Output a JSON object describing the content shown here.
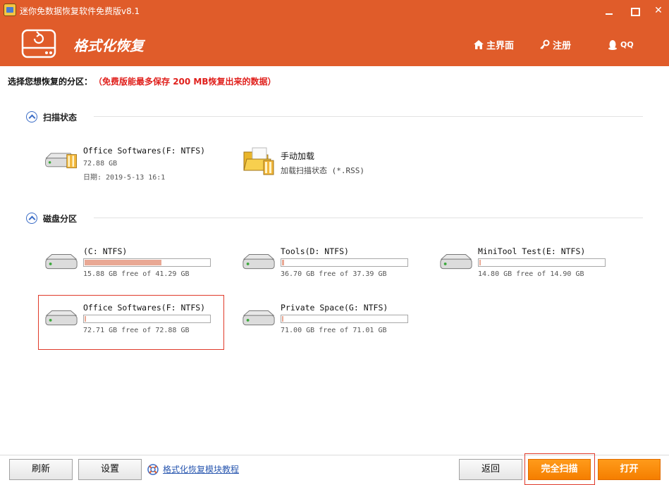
{
  "window": {
    "title": "迷你免数据恢复软件免费版v8.1"
  },
  "header": {
    "title": "格式化恢复",
    "nav": {
      "home": "主界面",
      "register": "注册",
      "qq": "QQ"
    }
  },
  "prompt": {
    "label": "选择您想恢复的分区：",
    "warning": "（免费版能最多保存 200 MB恢复出来的数据）"
  },
  "scan_state": {
    "title": "扫描状态",
    "last_scan": {
      "name": "Office Softwares(F: NTFS)",
      "size": "72.88 GB",
      "date": "日期: 2019-5-13 16:1"
    },
    "manual_load": {
      "name": "手动加载",
      "desc": "加载扫描状态 (*.RSS)"
    }
  },
  "disk_partitions": {
    "title": "磁盘分区",
    "items": [
      {
        "name": "(C: NTFS)",
        "free": "15.88 GB free of 41.29 GB",
        "used_fraction": 0.615
      },
      {
        "name": "Tools(D: NTFS)",
        "free": "36.70 GB free of 37.39 GB",
        "used_fraction": 0.018
      },
      {
        "name": "MiniTool Test(E: NTFS)",
        "free": "14.80 GB free of 14.90 GB",
        "used_fraction": 0.007
      },
      {
        "name": "Office Softwares(F: NTFS)",
        "free": "72.71 GB free of 72.88 GB",
        "used_fraction": 0.002
      },
      {
        "name": "Private Space(G: NTFS)",
        "free": "71.00 GB free of 71.01 GB",
        "used_fraction": 0.0001
      }
    ]
  },
  "footer": {
    "refresh": "刷新",
    "settings": "设置",
    "tutorial": "格式化恢复模块教程",
    "back": "返回",
    "full_scan": "完全扫描",
    "open": "打开"
  },
  "colors": {
    "brand": "#e05c2a",
    "usage_fill": "#e9a894",
    "warning": "#e0201c",
    "action": "#f57e00"
  }
}
